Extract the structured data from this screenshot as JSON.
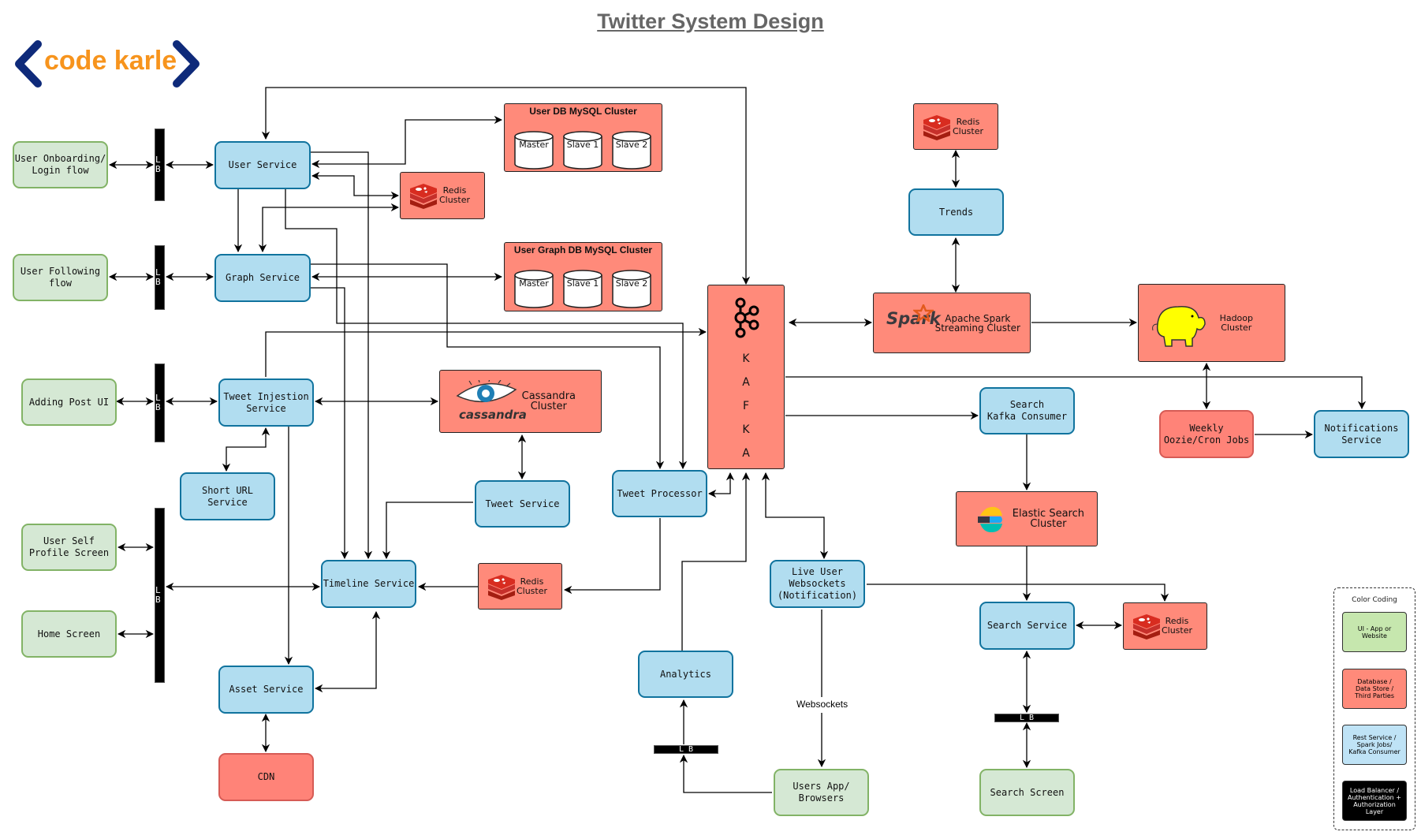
{
  "title": "Twitter System Design",
  "logo": {
    "text": "code karle",
    "bracket_color": "#0E2A7A",
    "text_color": "#F7941D"
  },
  "colors": {
    "ui": "#D5E8D4",
    "service": "#B1DDF0",
    "database": "#FF8A7A",
    "load_balancer": "#000000"
  },
  "ui_clients": {
    "onboarding": "User Onboarding/\nLogin flow",
    "following": "User Following\nflow",
    "adding_post": "Adding Post UI",
    "self_profile": "User Self\nProfile Screen",
    "home": "Home Screen",
    "users_app": "Users App/\nBrowsers",
    "search_screen": "Search Screen"
  },
  "load_balancer": {
    "label_vertical": "L\nB",
    "label_horizontal": "L B"
  },
  "services": {
    "user": "User Service",
    "graph": "Graph Service",
    "tweet_injestion": "Tweet Injestion\nService",
    "short_url": "Short URL\nService",
    "tweet_service": "Tweet Service",
    "tweet_processor": "Tweet Processor",
    "timeline": "Timeline Service",
    "asset": "Asset Service",
    "analytics": "Analytics",
    "live_user": "Live User\nWebsockets\n(Notification)",
    "trends": "Trends",
    "search_consumer": "Search\nKafka Consumer",
    "search_service": "Search Service",
    "notifications": "Notifications\nService"
  },
  "datastores": {
    "user_db": {
      "title": "User DB MySQL Cluster",
      "nodes": [
        "Master",
        "Slave 1",
        "Slave 2"
      ]
    },
    "graph_db": {
      "title": "User Graph DB MySQL Cluster",
      "nodes": [
        "Master",
        "Slave 1",
        "Slave 2"
      ]
    },
    "redis_label": "Redis\nCluster",
    "cassandra": {
      "label": "Cassandra\nCluster",
      "brand": "cassandra"
    },
    "kafka": {
      "letters": "K\nA\nF\nK\nA"
    },
    "spark": {
      "label": "Apache Spark\nStreaming Cluster",
      "brand": "Spark"
    },
    "hadoop": "Hadoop\nCluster",
    "elastic": "Elastic Search\nCluster",
    "cdn": "CDN",
    "weekly_jobs": "Weekly\nOozie/Cron Jobs"
  },
  "edge_labels": {
    "websockets": "Websockets"
  },
  "legend": {
    "title": "Color Coding",
    "items": [
      {
        "label": "UI - App or\nWebsite",
        "color": "#C6E7AE"
      },
      {
        "label": "Database /\nData Store /\nThird Parties",
        "color": "#FF8A7A"
      },
      {
        "label": "Rest Service /\nSpark Jobs/\nKafka Consumer",
        "color": "#BFE3F6"
      },
      {
        "label": "Load Balancer /\nAuthentication +\nAuthorization\nLayer",
        "color": "#000000"
      }
    ]
  }
}
